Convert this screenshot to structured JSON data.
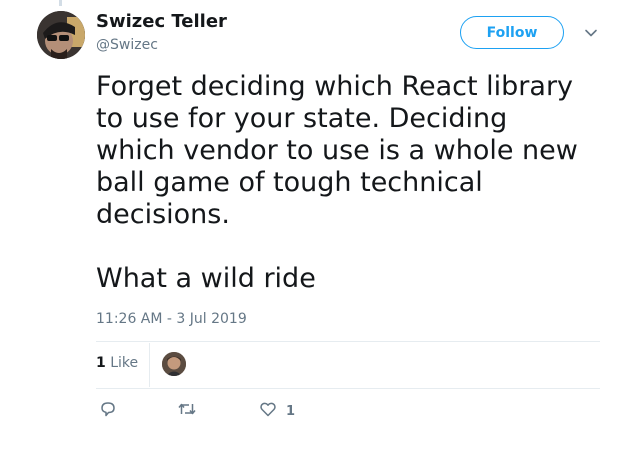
{
  "author": {
    "display_name": "Swizec Teller",
    "handle": "@Swizec"
  },
  "follow_button": {
    "label": "Follow"
  },
  "tweet": {
    "text": "Forget deciding which React library\nto use for your state. Deciding\nwhich vendor to use is a whole new\nball game of tough technical\ndecisions.\n\nWhat a wild ride",
    "timestamp": "11:26 AM - 3 Jul 2019"
  },
  "stats": {
    "likes_count": "1",
    "likes_label": "Like"
  },
  "actions": {
    "reply_icon": "reply-icon",
    "retweet_icon": "retweet-icon",
    "like_icon": "heart-icon",
    "like_count": "1"
  },
  "colors": {
    "accent": "#1da1f2",
    "secondary_text": "#657786",
    "primary_text": "#14171a",
    "divider": "#e6ecf0"
  }
}
